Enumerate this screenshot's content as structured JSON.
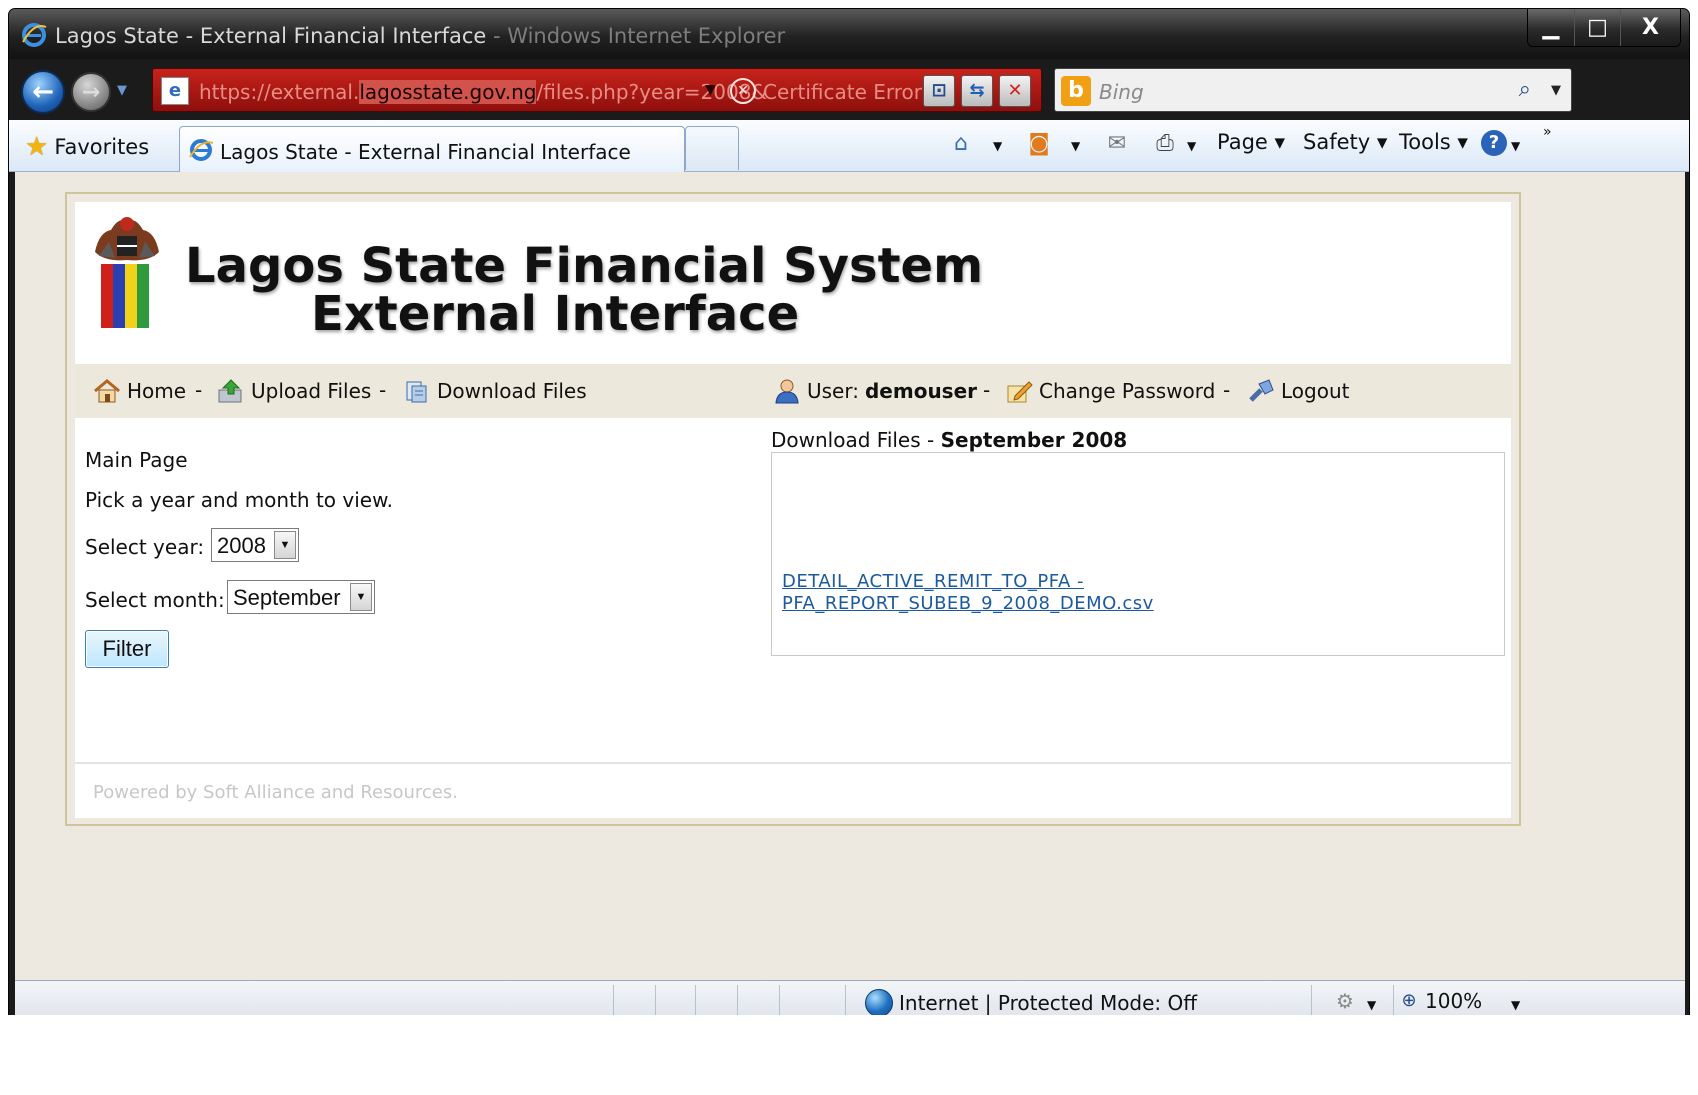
{
  "window": {
    "title_main": "Lagos State - External Financial Interface",
    "title_suffix": " - Windows Internet Explorer",
    "minimize": "▁",
    "maximize": "□",
    "close": "X"
  },
  "address": {
    "url_prefix": "https://external.",
    "url_host": "lagosstate.gov.ng",
    "url_path": "/files.php?year=2008&",
    "certificate": "Certificate Error",
    "search_placeholder": "Bing"
  },
  "toolbar": {
    "favorites": "Favorites",
    "tab_title": "Lagos State - External Financial Interface",
    "page": "Page",
    "safety": "Safety",
    "tools": "Tools",
    "help": "?"
  },
  "site": {
    "title_line1": "Lagos State Financial System",
    "title_line2": "External Interface"
  },
  "menu": {
    "home": "Home",
    "upload": "Upload Files",
    "download": "Download Files",
    "user_label": "User:",
    "username": "demouser",
    "change_password": "Change Password",
    "logout": "Logout",
    "separator": "-"
  },
  "left": {
    "heading": "Main Page",
    "instruction": "Pick a year and month to view.",
    "year_label": "Select year:",
    "year_value": "2008",
    "month_label": "Select month:",
    "month_value": "September",
    "filter_button": "Filter"
  },
  "downloads": {
    "label": "Download Files - ",
    "period": "September 2008",
    "file_line1": "DETAIL_ACTIVE_REMIT_TO_PFA -",
    "file_line2": "PFA_REPORT_SUBEB_9_2008_DEMO.csv"
  },
  "footer": {
    "text": "Powered by Soft Alliance and Resources."
  },
  "statusbar": {
    "zone": "Internet | Protected Mode: Off",
    "zoom": "100%"
  }
}
